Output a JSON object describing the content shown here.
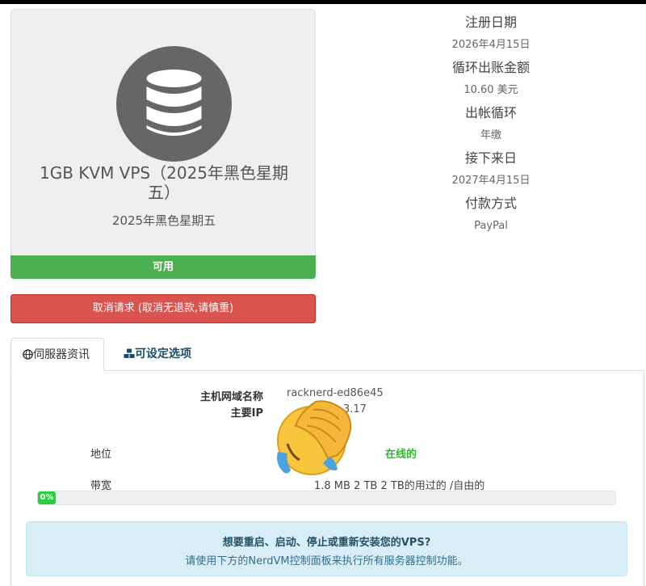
{
  "product": {
    "name": "1GB KVM VPS（2025年黑色星期五）",
    "group": "2025年黑色星期五",
    "icon": "database-icon",
    "status": "可用",
    "status_color": "#4caf50"
  },
  "cancel_button": {
    "label": "取消请求 (取消无退款,请慎重)",
    "color": "#d9534f"
  },
  "info": [
    {
      "label": "注册日期",
      "value": "2026年4月15日"
    },
    {
      "label": "循环出账金额",
      "value": "10.60 美元"
    },
    {
      "label": "出帐循环",
      "value": "年缴"
    },
    {
      "label": "接下来日",
      "value": "2027年4月15日"
    },
    {
      "label": "付款方式",
      "value": "PayPal"
    }
  ],
  "tabs": [
    {
      "label": "伺服器资讯",
      "icon": "globe-icon"
    },
    {
      "label": "可设定选项",
      "icon": "cubes-icon"
    }
  ],
  "server": {
    "hostname_label": "主机网域名称",
    "hostname_value": "racknerd-ed86e45",
    "ip_label": "主要IP",
    "ip_value_partial": "3.17",
    "status_label": "地位",
    "status_value": "在线的",
    "bandwidth_label": "带宽",
    "bandwidth_value": "1.8 MB 2 TB 2 TB的用过的 /自由的",
    "bandwidth_percent": 0,
    "bandwidth_percent_label": "0%"
  },
  "alert": {
    "title": "想要重启、启动、停止或重新安装您的VPS?",
    "text": "请使用下方的NerdVM控制面板来执行所有服务器控制功能。"
  },
  "overlay": {
    "emoji": "face-palm-emoji"
  }
}
